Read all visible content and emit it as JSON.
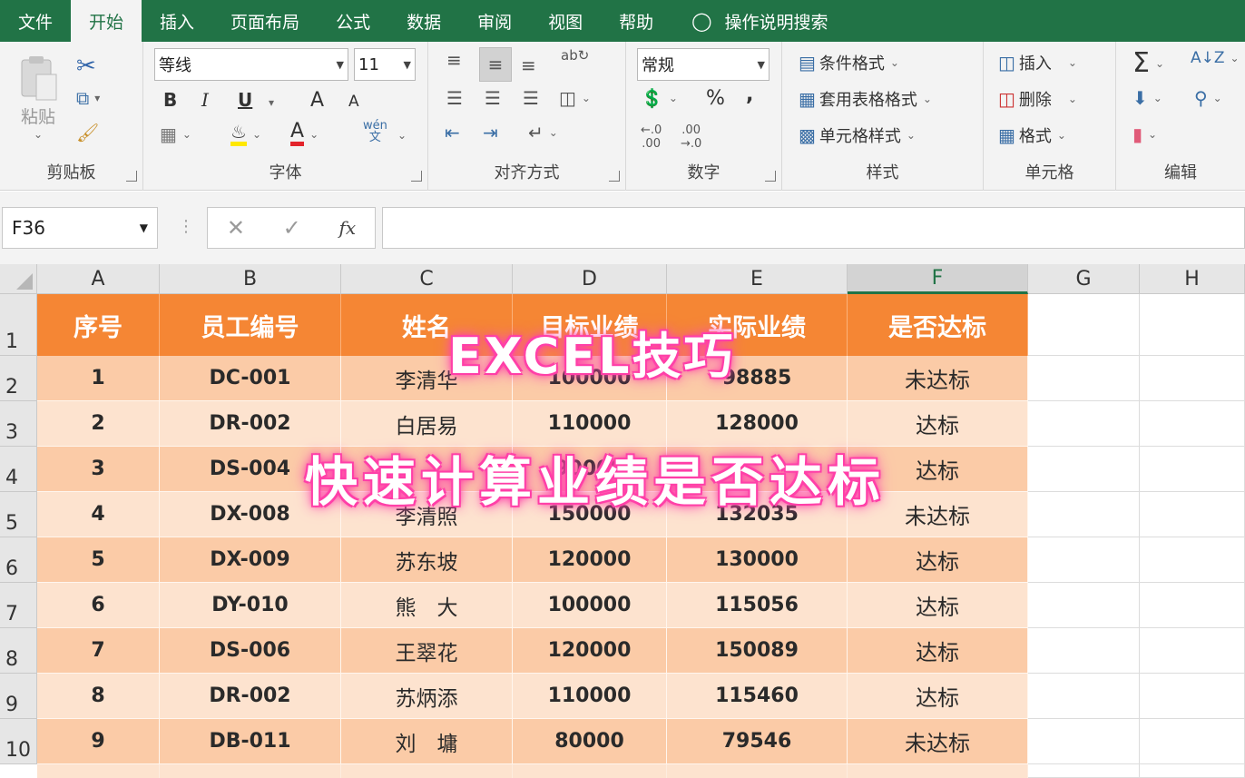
{
  "tabs": [
    "文件",
    "开始",
    "插入",
    "页面布局",
    "公式",
    "数据",
    "审阅",
    "视图",
    "帮助"
  ],
  "active_tab": "开始",
  "tell_me": "操作说明搜索",
  "ribbon": {
    "clipboard": {
      "label": "剪贴板",
      "paste": "粘贴"
    },
    "font": {
      "label": "字体",
      "font_name": "等线",
      "font_size": "11",
      "bold": "B",
      "italic": "I",
      "underline": "U",
      "grow": "A",
      "shrink": "A",
      "phonetic": "wén\n文"
    },
    "alignment": {
      "label": "对齐方式"
    },
    "number": {
      "label": "数字",
      "format": "常规",
      "percent": "%",
      "comma": ","
    },
    "styles": {
      "label": "样式",
      "conditional": "条件格式",
      "table": "套用表格格式",
      "cell_styles": "单元格样式"
    },
    "cells": {
      "label": "单元格",
      "insert": "插入",
      "delete": "删除",
      "format": "格式"
    },
    "editing": {
      "label": "编辑"
    }
  },
  "formula_bar": {
    "name_box": "F36",
    "formula": ""
  },
  "columns": [
    "A",
    "B",
    "C",
    "D",
    "E",
    "F",
    "G",
    "H"
  ],
  "rows": [
    "1",
    "2",
    "3",
    "4",
    "5",
    "6",
    "7",
    "8",
    "9",
    "10"
  ],
  "table": {
    "headers": [
      "序号",
      "员工编号",
      "姓名",
      "目标业绩",
      "实际业绩",
      "是否达标"
    ],
    "rows": [
      [
        "1",
        "DC-001",
        "李清华",
        "100000",
        "98885",
        "未达标"
      ],
      [
        "2",
        "DR-002",
        "白居易",
        "110000",
        "128000",
        "达标"
      ],
      [
        "3",
        "DS-004",
        "",
        "90000",
        "",
        "达标"
      ],
      [
        "4",
        "DX-008",
        "李清照",
        "150000",
        "132035",
        "未达标"
      ],
      [
        "5",
        "DX-009",
        "苏东坡",
        "120000",
        "130000",
        "达标"
      ],
      [
        "6",
        "DY-010",
        "熊　大",
        "100000",
        "115056",
        "达标"
      ],
      [
        "7",
        "DS-006",
        "王翠花",
        "120000",
        "150089",
        "达标"
      ],
      [
        "8",
        "DR-002",
        "苏炳添",
        "110000",
        "115460",
        "达标"
      ],
      [
        "9",
        "DB-011",
        "刘　墉",
        "80000",
        "79546",
        "未达标"
      ]
    ]
  },
  "overlay": {
    "line1": "EXCEL技巧",
    "line2": "快速计算业绩是否达标"
  },
  "colors": {
    "header_orange": "#f58634",
    "row_dark": "#fbcba7",
    "row_light": "#fde3cf",
    "excel_green": "#217346"
  }
}
